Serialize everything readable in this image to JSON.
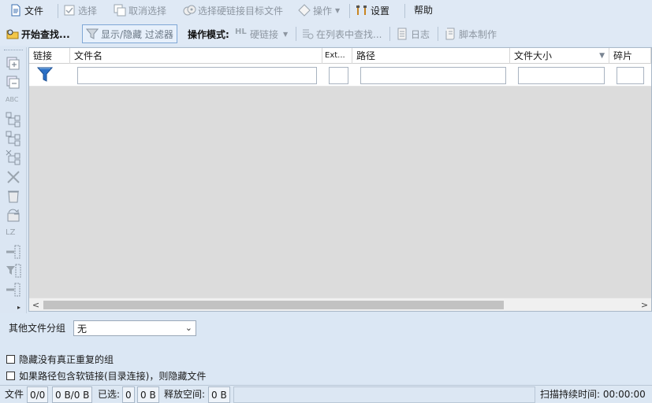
{
  "menu": {
    "file": "文件",
    "select": "选择",
    "deselect": "取消选择",
    "select_hardlink_target": "选择硬链接目标文件",
    "operations": "操作",
    "settings": "设置",
    "help": "帮助"
  },
  "toolbar": {
    "start_search": "开始查找...",
    "toggle_filter": "显示/隐藏 过滤器",
    "op_mode_label": "操作模式:",
    "hardlink": "硬链接",
    "find_in_list": "在列表中查找...",
    "log": "日志",
    "script": "脚本制作"
  },
  "grid": {
    "columns": [
      "链接",
      "文件名",
      "Ext...",
      "路径",
      "文件大小",
      "碎片"
    ]
  },
  "options": {
    "other_groups_label": "其他文件分组",
    "other_groups_value": "无",
    "hide_no_real_dup": "隐藏没有真正重复的组",
    "hide_symlink_path": "如果路径包含软链接(目录连接)，则隐藏文件"
  },
  "status": {
    "files_label": "文件",
    "files_count": "0/0",
    "files_size": "0 B/0 B",
    "selected_label": "已选:",
    "selected_count": "0",
    "selected_size": "0 B",
    "free_label": "释放空间:",
    "free_value": "0 B",
    "scan_duration": "扫描持续时间: 00:00:00"
  },
  "colors": {
    "accent_blue": "#2b6fc5",
    "background": "#dbe7f4",
    "grid_empty": "#dcdcdc"
  }
}
